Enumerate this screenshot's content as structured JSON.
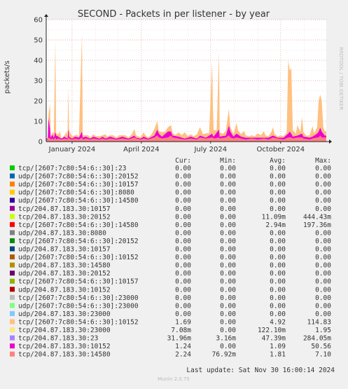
{
  "chart_data": {
    "type": "area",
    "title": "SECOND - Packets in per listener - by year",
    "ylabel": "packets/s",
    "xlabel": "",
    "ylim": [
      0,
      60
    ],
    "yticks": [
      0,
      10,
      20,
      30,
      40,
      50,
      60
    ],
    "xticks": [
      "January 2024",
      "April 2024",
      "July 2024",
      "October 2024"
    ],
    "watermark": "RRDTOOL / TOBI OETIKER",
    "grid": true,
    "stacked": true,
    "x_range_dates": [
      "2023-11-28",
      "2024-11-30"
    ],
    "columns": [
      "Cur:",
      "Min:",
      "Avg:",
      "Max:"
    ],
    "legend": [
      {
        "name": "tcp/[2607:7c80:54:6::30]:23",
        "color": "#00cc00",
        "cur": "0.00",
        "min": "0.00",
        "avg": "0.00",
        "max": "0.00"
      },
      {
        "name": "udp/[2607:7c80:54:6::30]:20152",
        "color": "#0066b3",
        "cur": "0.00",
        "min": "0.00",
        "avg": "0.00",
        "max": "0.00"
      },
      {
        "name": "udp/[2607:7c80:54:6::30]:10157",
        "color": "#ff8000",
        "cur": "0.00",
        "min": "0.00",
        "avg": "0.00",
        "max": "0.00"
      },
      {
        "name": "udp/[2607:7c80:54:6::30]:8080",
        "color": "#ffcc00",
        "cur": "0.00",
        "min": "0.00",
        "avg": "0.00",
        "max": "0.00"
      },
      {
        "name": "udp/[2607:7c80:54:6::30]:14580",
        "color": "#330099",
        "cur": "0.00",
        "min": "0.00",
        "avg": "0.00",
        "max": "0.00"
      },
      {
        "name": "tcp/204.87.183.30:10157",
        "color": "#990099",
        "cur": "0.00",
        "min": "0.00",
        "avg": "0.00",
        "max": "0.00"
      },
      {
        "name": "tcp/204.87.183.30:20152",
        "color": "#ccff00",
        "cur": "0.00",
        "min": "0.00",
        "avg": "11.09m",
        "max": "444.43m"
      },
      {
        "name": "tcp/[2607:7c80:54:6::30]:14580",
        "color": "#ff0000",
        "cur": "0.00",
        "min": "0.00",
        "avg": "2.94m",
        "max": "197.36m"
      },
      {
        "name": "udp/204.87.183.30:8080",
        "color": "#808080",
        "cur": "0.00",
        "min": "0.00",
        "avg": "0.00",
        "max": "0.00"
      },
      {
        "name": "tcp/[2607:7c80:54:6::30]:20152",
        "color": "#008f00",
        "cur": "0.00",
        "min": "0.00",
        "avg": "0.00",
        "max": "0.00"
      },
      {
        "name": "udp/204.87.183.30:10157",
        "color": "#00487d",
        "cur": "0.00",
        "min": "0.00",
        "avg": "0.00",
        "max": "0.00"
      },
      {
        "name": "udp/[2607:7c80:54:6::30]:10152",
        "color": "#b35a00",
        "cur": "0.00",
        "min": "0.00",
        "avg": "0.00",
        "max": "0.00"
      },
      {
        "name": "udp/204.87.183.30:14580",
        "color": "#b38f00",
        "cur": "0.00",
        "min": "0.00",
        "avg": "0.00",
        "max": "0.00"
      },
      {
        "name": "udp/204.87.183.30:20152",
        "color": "#6b006b",
        "cur": "0.00",
        "min": "0.00",
        "avg": "0.00",
        "max": "0.00"
      },
      {
        "name": "tcp/[2607:7c80:54:6::30]:10157",
        "color": "#8fb300",
        "cur": "0.00",
        "min": "0.00",
        "avg": "0.00",
        "max": "0.00"
      },
      {
        "name": "udp/204.87.183.30:10152",
        "color": "#b30000",
        "cur": "0.00",
        "min": "0.00",
        "avg": "0.00",
        "max": "0.00"
      },
      {
        "name": "tcp/[2607:7c80:54:6::30]:23000",
        "color": "#bebebe",
        "cur": "0.00",
        "min": "0.00",
        "avg": "0.00",
        "max": "0.00"
      },
      {
        "name": "udp/[2607:7c80:54:6::30]:23000",
        "color": "#80ff80",
        "cur": "0.00",
        "min": "0.00",
        "avg": "0.00",
        "max": "0.00"
      },
      {
        "name": "udp/204.87.183.30:23000",
        "color": "#80c9ff",
        "cur": "0.00",
        "min": "0.00",
        "avg": "0.00",
        "max": "0.00"
      },
      {
        "name": "tcp/[2607:7c80:54:6::30]:10152",
        "color": "#ffc080",
        "cur": "1.69",
        "min": "0.00",
        "avg": "4.92",
        "max": "114.83"
      },
      {
        "name": "tcp/204.87.183.30:23000",
        "color": "#ffe680",
        "cur": "7.08m",
        "min": "0.00",
        "avg": "122.10m",
        "max": "1.95"
      },
      {
        "name": "tcp/204.87.183.30:23",
        "color": "#aa80ff",
        "cur": "31.96m",
        "min": "3.16m",
        "avg": "47.39m",
        "max": "284.05m"
      },
      {
        "name": "tcp/204.87.183.30:10152",
        "color": "#ee00cc",
        "cur": "1.24",
        "min": "0.00",
        "avg": "1.09",
        "max": "50.56"
      },
      {
        "name": "tcp/204.87.183.30:14580",
        "color": "#ff8080",
        "cur": "2.24",
        "min": "76.92m",
        "avg": "1.81",
        "max": "7.10"
      }
    ],
    "series_values": {
      "tcp/[2607:7c80:54:6::30]:10152": [
        [
          2,
          0
        ],
        [
          3,
          1
        ],
        [
          5,
          12
        ],
        [
          6,
          0.5
        ],
        [
          8,
          1
        ],
        [
          10,
          2
        ],
        [
          12,
          45
        ],
        [
          13,
          1
        ],
        [
          16,
          1
        ],
        [
          18,
          3
        ],
        [
          20,
          0
        ],
        [
          24,
          0.5
        ],
        [
          27,
          3
        ],
        [
          28,
          1
        ],
        [
          29,
          20
        ],
        [
          30,
          3
        ],
        [
          34,
          1
        ],
        [
          38,
          0.5
        ],
        [
          40,
          1
        ],
        [
          43,
          0.5
        ],
        [
          47,
          48
        ],
        [
          48,
          1
        ],
        [
          52,
          0.5
        ],
        [
          55,
          1
        ],
        [
          58,
          0.5
        ],
        [
          62,
          1
        ],
        [
          65,
          0.5
        ],
        [
          70,
          1
        ],
        [
          74,
          0.5
        ],
        [
          78,
          2
        ],
        [
          80,
          0.5
        ],
        [
          84,
          0.5
        ],
        [
          88,
          1
        ],
        [
          92,
          0.5
        ],
        [
          96,
          1
        ],
        [
          100,
          0.5
        ],
        [
          104,
          1
        ],
        [
          108,
          0.5
        ],
        [
          112,
          1
        ],
        [
          116,
          3
        ],
        [
          118,
          1
        ],
        [
          124,
          0.5
        ],
        [
          128,
          2
        ],
        [
          130,
          1
        ],
        [
          134,
          0.5
        ],
        [
          138,
          1
        ],
        [
          142,
          3
        ],
        [
          146,
          4
        ],
        [
          148,
          1
        ],
        [
          152,
          2
        ],
        [
          156,
          1
        ],
        [
          160,
          2
        ],
        [
          164,
          3
        ],
        [
          166,
          1
        ],
        [
          170,
          0.5
        ],
        [
          174,
          2
        ],
        [
          178,
          1
        ],
        [
          182,
          3
        ],
        [
          186,
          0.5
        ],
        [
          190,
          1
        ],
        [
          194,
          0.5
        ],
        [
          198,
          2
        ],
        [
          202,
          4
        ],
        [
          206,
          1
        ],
        [
          210,
          2
        ],
        [
          214,
          1
        ],
        [
          218,
          35
        ],
        [
          219,
          15
        ],
        [
          220,
          3
        ],
        [
          224,
          1
        ],
        [
          227,
          38
        ],
        [
          228,
          2
        ],
        [
          232,
          1
        ],
        [
          236,
          2
        ],
        [
          240,
          8
        ],
        [
          242,
          2
        ],
        [
          246,
          1
        ],
        [
          250,
          5
        ],
        [
          252,
          2
        ],
        [
          256,
          1
        ],
        [
          260,
          3
        ],
        [
          262,
          1
        ],
        [
          266,
          0.5
        ],
        [
          270,
          1
        ],
        [
          274,
          0.5
        ],
        [
          278,
          2
        ],
        [
          282,
          1
        ],
        [
          286,
          3
        ],
        [
          288,
          1
        ],
        [
          292,
          0.5
        ],
        [
          296,
          2
        ],
        [
          298,
          4
        ],
        [
          300,
          1
        ],
        [
          304,
          0.5
        ],
        [
          308,
          1
        ],
        [
          312,
          0.5
        ],
        [
          316,
          1
        ],
        [
          318,
          36
        ],
        [
          320,
          30
        ],
        [
          322,
          32
        ],
        [
          324,
          3
        ],
        [
          328,
          1
        ],
        [
          330,
          5
        ],
        [
          334,
          1
        ],
        [
          336,
          8
        ],
        [
          338,
          2
        ],
        [
          342,
          0.5
        ],
        [
          346,
          1
        ],
        [
          350,
          5
        ],
        [
          352,
          1
        ],
        [
          356,
          3
        ],
        [
          358,
          15
        ],
        [
          360,
          16
        ],
        [
          362,
          15
        ],
        [
          364,
          3
        ],
        [
          366,
          2
        ],
        [
          368,
          2
        ]
      ],
      "tcp/204.87.183.30:10152": [
        [
          2,
          0.5
        ],
        [
          3,
          10
        ],
        [
          5,
          5
        ],
        [
          6,
          1
        ],
        [
          8,
          2
        ],
        [
          10,
          1
        ],
        [
          12,
          3
        ],
        [
          13,
          2
        ],
        [
          16,
          1
        ],
        [
          20,
          0.5
        ],
        [
          24,
          1
        ],
        [
          28,
          0.5
        ],
        [
          29,
          5
        ],
        [
          30,
          1
        ],
        [
          34,
          0.5
        ],
        [
          38,
          1
        ],
        [
          43,
          1
        ],
        [
          47,
          3
        ],
        [
          48,
          1
        ],
        [
          52,
          1
        ],
        [
          58,
          0.5
        ],
        [
          62,
          1
        ],
        [
          70,
          0.5
        ],
        [
          74,
          1
        ],
        [
          78,
          0.5
        ],
        [
          84,
          1
        ],
        [
          92,
          0.5
        ],
        [
          100,
          1
        ],
        [
          108,
          0.5
        ],
        [
          116,
          1
        ],
        [
          118,
          0.5
        ],
        [
          124,
          0.5
        ],
        [
          128,
          1
        ],
        [
          134,
          0.5
        ],
        [
          142,
          1
        ],
        [
          146,
          3
        ],
        [
          148,
          2
        ],
        [
          152,
          1
        ],
        [
          160,
          3
        ],
        [
          164,
          2
        ],
        [
          166,
          1
        ],
        [
          174,
          1
        ],
        [
          182,
          0.5
        ],
        [
          190,
          1
        ],
        [
          198,
          0.5
        ],
        [
          202,
          1
        ],
        [
          210,
          0.5
        ],
        [
          218,
          2
        ],
        [
          219,
          1
        ],
        [
          220,
          1
        ],
        [
          227,
          4
        ],
        [
          228,
          1
        ],
        [
          236,
          1
        ],
        [
          240,
          5
        ],
        [
          242,
          3
        ],
        [
          246,
          1
        ],
        [
          250,
          2
        ],
        [
          256,
          1
        ],
        [
          262,
          1
        ],
        [
          270,
          0.5
        ],
        [
          278,
          1
        ],
        [
          286,
          0.5
        ],
        [
          292,
          1
        ],
        [
          298,
          1
        ],
        [
          304,
          0.5
        ],
        [
          312,
          1
        ],
        [
          318,
          2
        ],
        [
          320,
          3
        ],
        [
          322,
          2
        ],
        [
          324,
          1
        ],
        [
          330,
          1
        ],
        [
          336,
          2
        ],
        [
          338,
          1
        ],
        [
          346,
          1
        ],
        [
          350,
          1
        ],
        [
          356,
          2
        ],
        [
          358,
          3
        ],
        [
          360,
          4
        ],
        [
          362,
          3
        ],
        [
          364,
          2
        ],
        [
          366,
          1
        ],
        [
          368,
          1
        ]
      ],
      "tcp/204.87.183.30:14580": [
        [
          2,
          1
        ],
        [
          3,
          2
        ],
        [
          5,
          1.5
        ],
        [
          6,
          1
        ],
        [
          8,
          1.5
        ],
        [
          10,
          1
        ],
        [
          12,
          2
        ],
        [
          13,
          1
        ],
        [
          16,
          1.5
        ],
        [
          20,
          1
        ],
        [
          24,
          1.5
        ],
        [
          28,
          1
        ],
        [
          29,
          2
        ],
        [
          30,
          1.5
        ],
        [
          34,
          1
        ],
        [
          38,
          1.5
        ],
        [
          43,
          1
        ],
        [
          47,
          2
        ],
        [
          48,
          1
        ],
        [
          52,
          1.5
        ],
        [
          58,
          1
        ],
        [
          62,
          1.5
        ],
        [
          70,
          1
        ],
        [
          74,
          1.5
        ],
        [
          78,
          1
        ],
        [
          84,
          1.5
        ],
        [
          92,
          1
        ],
        [
          100,
          1.5
        ],
        [
          108,
          1
        ],
        [
          116,
          2
        ],
        [
          118,
          1.5
        ],
        [
          124,
          1
        ],
        [
          128,
          1.5
        ],
        [
          134,
          1
        ],
        [
          142,
          2
        ],
        [
          146,
          3
        ],
        [
          148,
          2
        ],
        [
          152,
          1.5
        ],
        [
          160,
          2
        ],
        [
          164,
          3
        ],
        [
          166,
          2
        ],
        [
          174,
          1.5
        ],
        [
          182,
          1
        ],
        [
          190,
          1.5
        ],
        [
          198,
          1
        ],
        [
          202,
          2
        ],
        [
          210,
          1.5
        ],
        [
          218,
          2
        ],
        [
          219,
          2
        ],
        [
          220,
          1.5
        ],
        [
          227,
          2
        ],
        [
          228,
          1.5
        ],
        [
          236,
          2
        ],
        [
          240,
          3
        ],
        [
          242,
          2
        ],
        [
          246,
          1.5
        ],
        [
          250,
          2
        ],
        [
          256,
          1.5
        ],
        [
          262,
          1
        ],
        [
          270,
          1.5
        ],
        [
          278,
          1
        ],
        [
          286,
          1.5
        ],
        [
          292,
          1
        ],
        [
          298,
          2
        ],
        [
          304,
          1.5
        ],
        [
          312,
          1
        ],
        [
          318,
          2
        ],
        [
          320,
          2
        ],
        [
          322,
          2
        ],
        [
          324,
          1.5
        ],
        [
          330,
          2
        ],
        [
          336,
          2
        ],
        [
          338,
          1.5
        ],
        [
          346,
          1
        ],
        [
          350,
          1.5
        ],
        [
          356,
          2
        ],
        [
          358,
          2
        ],
        [
          360,
          3
        ],
        [
          362,
          2
        ],
        [
          364,
          2
        ],
        [
          366,
          2
        ],
        [
          368,
          2
        ]
      ],
      "tcp/204.87.183.30:23000": [
        [
          2,
          0.1
        ],
        [
          100,
          0.1
        ],
        [
          200,
          0.1
        ],
        [
          368,
          0.1
        ]
      ]
    }
  },
  "footer": {
    "last_update": "Last update: Sat Nov 30 16:00:14 2024",
    "munin_version": "Munin 2.0.75"
  }
}
